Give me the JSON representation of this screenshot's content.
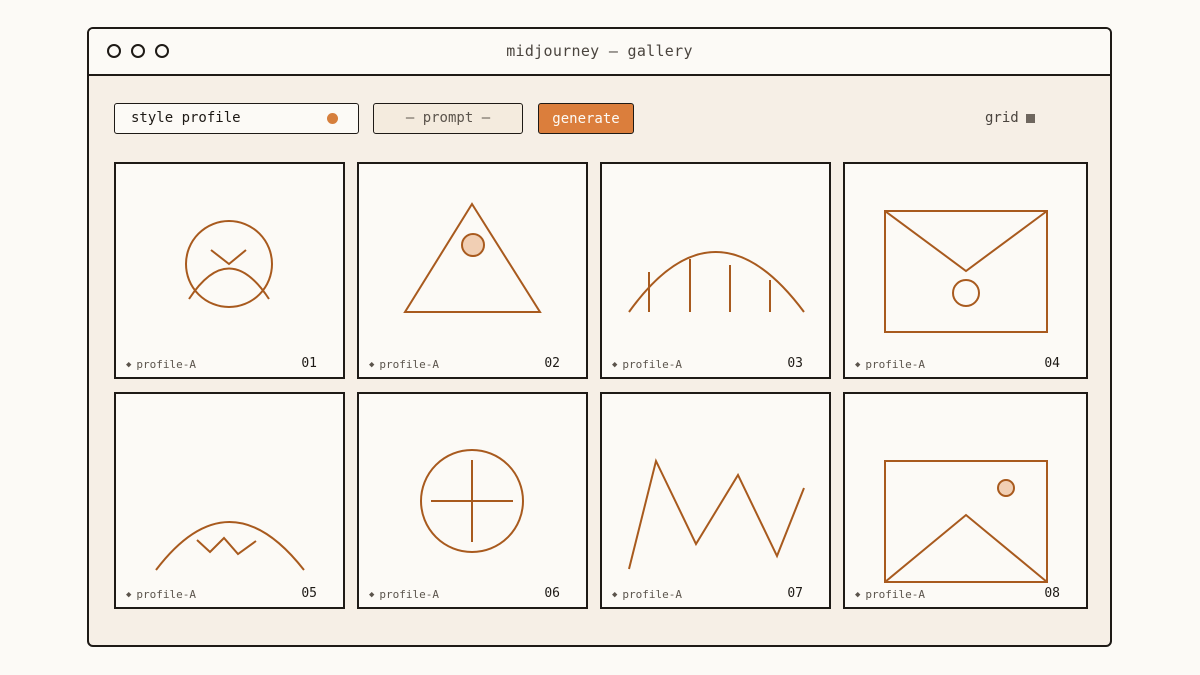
{
  "window": {
    "title": "midjourney — gallery"
  },
  "toolbar": {
    "style_label": "style profile",
    "prompt_placeholder": "— prompt —",
    "generate_label": "generate",
    "view_label": "grid"
  },
  "colors": {
    "accent": "#db7e3c",
    "stroke": "#a85a1e",
    "ink": "#1e1a16",
    "panel": "#f6efe6"
  },
  "tiles": [
    {
      "profile": "profile-A",
      "number": "01",
      "icon": "sun-face-icon"
    },
    {
      "profile": "profile-A",
      "number": "02",
      "icon": "triangle-dot-icon"
    },
    {
      "profile": "profile-A",
      "number": "03",
      "icon": "arc-bars-icon"
    },
    {
      "profile": "profile-A",
      "number": "04",
      "icon": "envelope-icon"
    },
    {
      "profile": "profile-A",
      "number": "05",
      "icon": "hill-zigzag-icon"
    },
    {
      "profile": "profile-A",
      "number": "06",
      "icon": "crosshair-circle-icon"
    },
    {
      "profile": "profile-A",
      "number": "07",
      "icon": "zigzag-line-icon"
    },
    {
      "profile": "profile-A",
      "number": "08",
      "icon": "landscape-image-icon"
    }
  ]
}
